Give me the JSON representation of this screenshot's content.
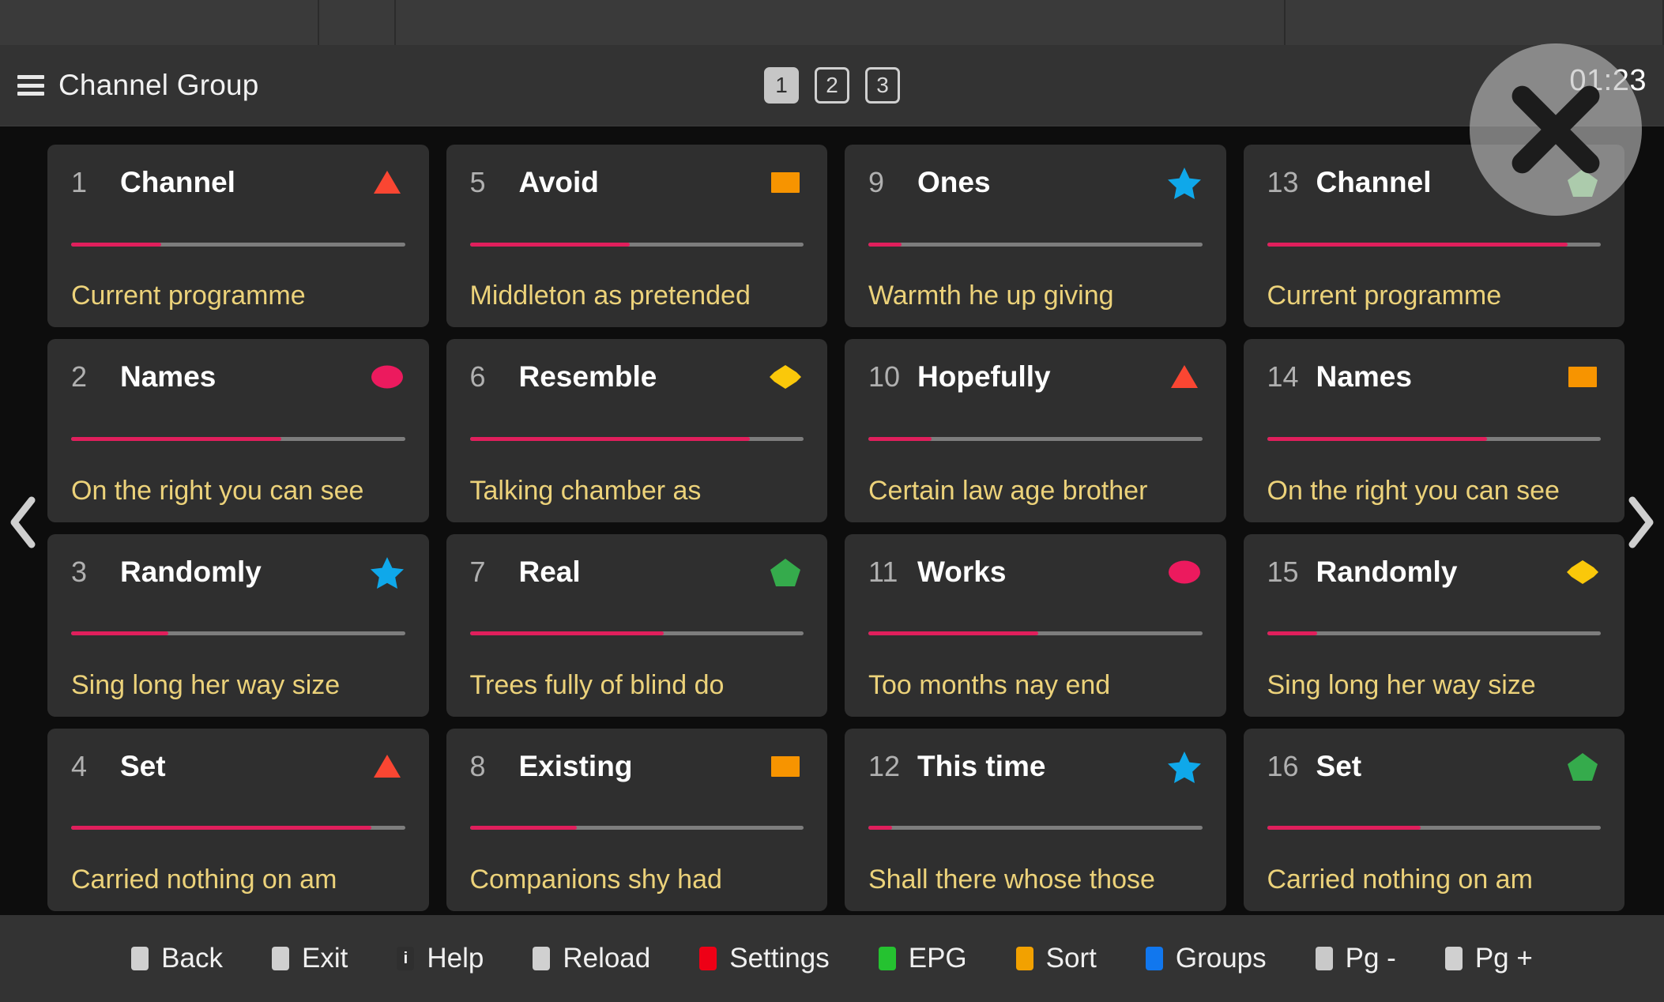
{
  "header": {
    "menu_icon": "hamburger-icon",
    "title": "Channel Group",
    "clock": "01:23",
    "pages": [
      {
        "label": "1",
        "state": "active"
      },
      {
        "label": "2",
        "state": "inactive"
      },
      {
        "label": "3",
        "state": "inactive"
      }
    ]
  },
  "close_button": {
    "icon": "close-icon"
  },
  "nav": {
    "prev_icon": "chevron-left-icon",
    "next_icon": "chevron-right-icon"
  },
  "colors": {
    "accent_progress": "#e01f5c",
    "subtitle": "#ecd27a",
    "card_bg": "#2f2f2f",
    "header_bg": "#333333",
    "icon_red": "#fa4632",
    "icon_pink": "#ec1a5e",
    "icon_blue": "#0fa8ea",
    "icon_orange": "#f79400",
    "icon_yellow": "#fac80a",
    "icon_green": "#35ab4c"
  },
  "channels": [
    {
      "number": "1",
      "title": "Channel",
      "subtitle": "Current programme",
      "progress": 27,
      "icon": "triangle-red-icon",
      "icon_shape": "triangle",
      "icon_color": "#fa4632"
    },
    {
      "number": "2",
      "title": "Names",
      "subtitle": "On the right you can see",
      "progress": 63,
      "icon": "circle-pink-icon",
      "icon_shape": "circle",
      "icon_color": "#ec1a5e"
    },
    {
      "number": "3",
      "title": "Randomly",
      "subtitle": "Sing long her way size",
      "progress": 29,
      "icon": "star-blue-icon",
      "icon_shape": "star",
      "icon_color": "#0fa8ea"
    },
    {
      "number": "4",
      "title": "Set",
      "subtitle": "Carried nothing on am",
      "progress": 90,
      "icon": "triangle-red-icon",
      "icon_shape": "triangle",
      "icon_color": "#fa4632"
    },
    {
      "number": "5",
      "title": "Avoid",
      "subtitle": "Middleton as pretended",
      "progress": 48,
      "icon": "square-orange-icon",
      "icon_shape": "square",
      "icon_color": "#f79400"
    },
    {
      "number": "6",
      "title": "Resemble",
      "subtitle": "Talking chamber as",
      "progress": 84,
      "icon": "diamond-yellow-icon",
      "icon_shape": "diamond",
      "icon_color": "#fac80a"
    },
    {
      "number": "7",
      "title": "Real",
      "subtitle": "Trees fully of blind do",
      "progress": 58,
      "icon": "pentagon-green-icon",
      "icon_shape": "pentagon",
      "icon_color": "#35ab4c"
    },
    {
      "number": "8",
      "title": "Existing",
      "subtitle": "Companions shy had",
      "progress": 32,
      "icon": "square-orange-icon",
      "icon_shape": "square",
      "icon_color": "#f79400"
    },
    {
      "number": "9",
      "title": "Ones",
      "subtitle": "Warmth he up giving",
      "progress": 10,
      "icon": "star-blue-icon",
      "icon_shape": "star",
      "icon_color": "#0fa8ea"
    },
    {
      "number": "10",
      "title": "Hopefully",
      "subtitle": "Certain law age brother",
      "progress": 19,
      "icon": "triangle-red-icon",
      "icon_shape": "triangle",
      "icon_color": "#fa4632"
    },
    {
      "number": "11",
      "title": "Works",
      "subtitle": "Too months nay end",
      "progress": 51,
      "icon": "circle-pink-icon",
      "icon_shape": "circle",
      "icon_color": "#ec1a5e"
    },
    {
      "number": "12",
      "title": "This time",
      "subtitle": "Shall there whose those",
      "progress": 7,
      "icon": "star-blue-icon",
      "icon_shape": "star",
      "icon_color": "#0fa8ea"
    },
    {
      "number": "13",
      "title": "Channel",
      "subtitle": "Current programme",
      "progress": 90,
      "icon": "pentagon-green-icon",
      "icon_shape": "pentagon",
      "icon_color": "#8fe08f"
    },
    {
      "number": "14",
      "title": "Names",
      "subtitle": "On the right you can see",
      "progress": 66,
      "icon": "square-orange-icon",
      "icon_shape": "square",
      "icon_color": "#f79400"
    },
    {
      "number": "15",
      "title": "Randomly",
      "subtitle": "Sing long her way size",
      "progress": 15,
      "icon": "diamond-yellow-icon",
      "icon_shape": "diamond",
      "icon_color": "#fac80a"
    },
    {
      "number": "16",
      "title": "Set",
      "subtitle": "Carried nothing on am",
      "progress": 46,
      "icon": "pentagon-green-icon",
      "icon_shape": "pentagon",
      "icon_color": "#35ab4c"
    }
  ],
  "bottom_bar": [
    {
      "label": "Back",
      "icon": "square-grey-icon",
      "color": "#d0d0d0",
      "glyph": ""
    },
    {
      "label": "Exit",
      "icon": "square-grey-icon",
      "color": "#d0d0d0",
      "glyph": ""
    },
    {
      "label": "Help",
      "icon": "info-icon",
      "color": "#2f2f2f",
      "glyph": "i"
    },
    {
      "label": "Reload",
      "icon": "square-grey-icon",
      "color": "#d0d0d0",
      "glyph": ""
    },
    {
      "label": "Settings",
      "icon": "square-red-icon",
      "color": "#ee0016",
      "glyph": ""
    },
    {
      "label": "EPG",
      "icon": "square-green-icon",
      "color": "#25c230",
      "glyph": ""
    },
    {
      "label": "Sort",
      "icon": "square-orange-icon",
      "color": "#f2a100",
      "glyph": ""
    },
    {
      "label": "Groups",
      "icon": "square-blue-icon",
      "color": "#1177ee",
      "glyph": ""
    },
    {
      "label": "Pg -",
      "icon": "square-grey-icon",
      "color": "#c9c9c9",
      "glyph": ""
    },
    {
      "label": "Pg +",
      "icon": "square-grey-icon",
      "color": "#d0d0d0",
      "glyph": ""
    }
  ]
}
